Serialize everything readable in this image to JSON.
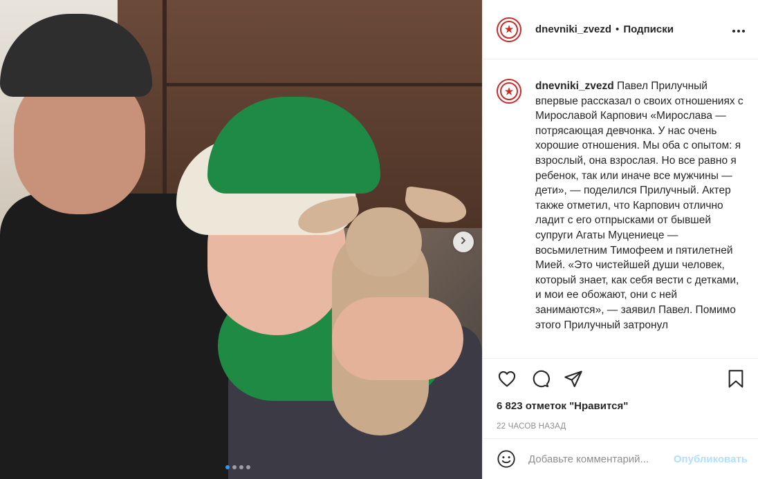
{
  "post": {
    "author": "dnevniki_zvezd",
    "separator": "•",
    "follow_label": "Подписки",
    "more_icon": "more-horizontal-icon",
    "caption_author": "dnevniki_zvezd",
    "caption_text": "Павел Прилучный впервые рассказал о своих отношениях с Мирославой Карпович «Мирослава — потрясающая девчонка. У нас очень хорошие отношения. Мы оба с опытом: я взрослый, она взрослая. Но все равно я ребенок, так или иначе все мужчины — дети», — поделился Прилучный. Актер также отметил, что Карпович отлично ладит с его отпрысками от бывшей супруги Агаты Муцениеце — восьмилетним Тимофеем и пятилетней Мией. «Это чистейшей души человек, который знает, как себя вести с детками, и мои ее обожают, они с ней занимаются», — заявил Павел. Помимо этого Прилучный затронул",
    "likes": "6 823 отметок \"Нравится\"",
    "time_ago": "22 ЧАСОВ НАЗАД",
    "comment_placeholder": "Добавьте комментарий...",
    "publish_label": "Опубликовать"
  },
  "carousel": {
    "total": 4,
    "active_index": 0,
    "next_icon": "chevron-right-icon"
  },
  "icons": {
    "like": "heart-icon",
    "comment": "comment-icon",
    "share": "send-icon",
    "save": "bookmark-icon",
    "emoji": "smiley-icon"
  },
  "colors": {
    "accent_blue": "#3897f0",
    "publish_disabled": "#b2dffc",
    "avatar_red": "#c92a2a",
    "muted_text": "#8e8e8e"
  }
}
